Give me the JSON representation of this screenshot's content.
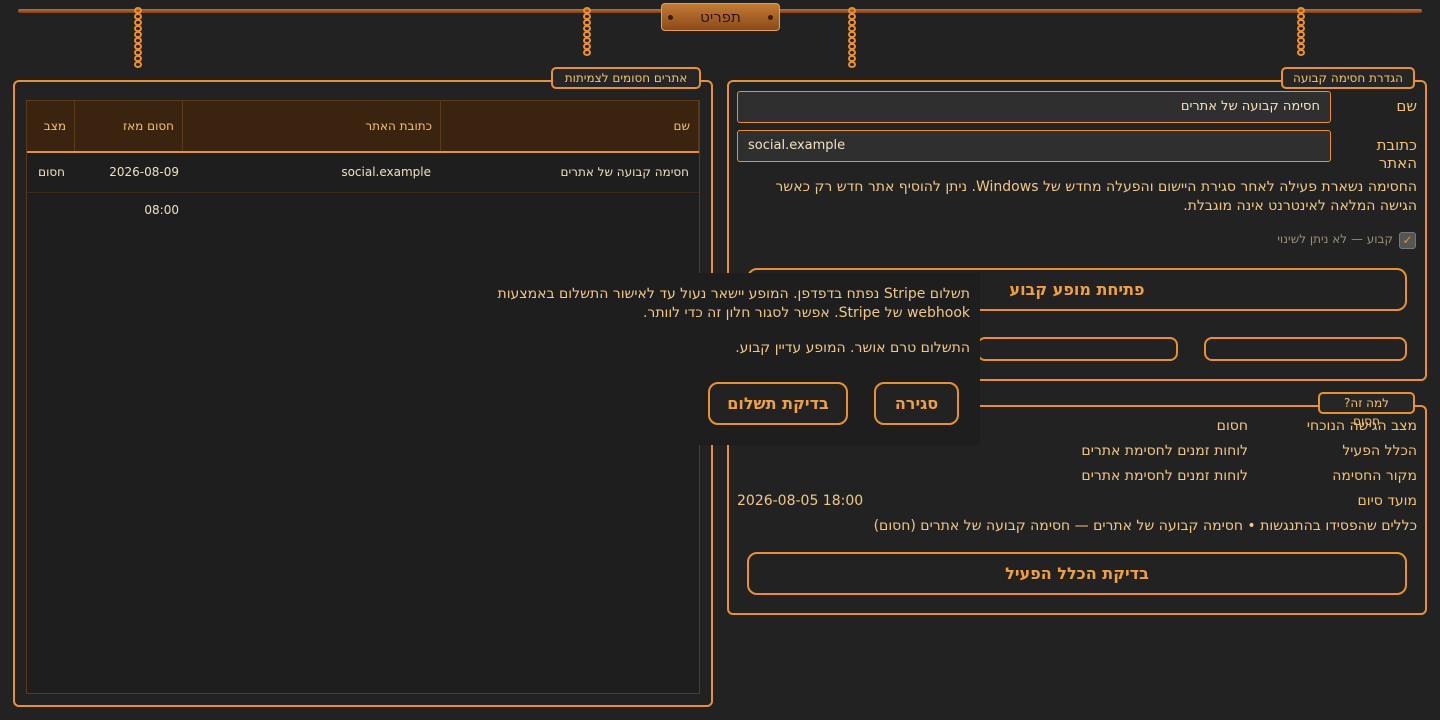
{
  "menu": {
    "label": "תפריט"
  },
  "blocked_sites": {
    "title": "אתרים חסומים לצמיתות",
    "columns": [
      "שם",
      "כתובת האתר",
      "חסום מאז",
      "מצב"
    ],
    "rows": [
      {
        "name": "חסימה קבועה של אתרים",
        "url": "social.example",
        "since": "2026-08-09 08:00",
        "status": "חסום"
      }
    ]
  },
  "permanent_block": {
    "title": "הגדרת חסימה קבועה",
    "name_label": "שם",
    "name_value": "חסימה קבועה של אתרים",
    "url_label": "כתובת האתר",
    "url_value": "social.example",
    "note": "החסימה נשארת פעילה לאחר סגירת היישום והפעלה מחדש של Windows. ניתן להוסיף אתר חדש רק כאשר הגישה המלאה לאינטרנט אינה מוגבלת.",
    "permanent_checkbox": {
      "label": "קבוע — לא ניתן לשינוי",
      "checked": true
    },
    "open_button": "פתיחת מופע קבוע"
  },
  "why_blocked": {
    "title": "?למה זה חסום",
    "items": [
      {
        "key": "מצב הגישה הנוכחי",
        "value": "חסום"
      },
      {
        "key": "הכלל הפעיל",
        "value": "לוחות זמנים לחסימת אתרים"
      },
      {
        "key": "מקור החסימה",
        "value": "לוחות זמנים לחסימת אתרים"
      },
      {
        "key": "מועד סיום",
        "value": "2026-08-05 18:00"
      }
    ],
    "conflicts": "כללים שהפסידו בהתנגשות • חסימה קבועה של אתרים — חסימה קבועה של אתרים (חסום)",
    "check_button": "בדיקת הכלל הפעיל"
  },
  "payment_dialog": {
    "message": "תשלום Stripe נפתח בדפדפן. המופע יישאר נעול עד לאישור התשלום באמצעות webhook של Stripe. אפשר לסגור חלון זה כדי לוותר.",
    "status": "התשלום טרם אושר. המופע עדיין קבוע.",
    "close_button": "סגירה",
    "check_button": "בדיקת תשלום"
  },
  "colors": {
    "accent": "#e8922e",
    "background": "#222222",
    "text": "#f0c070"
  }
}
